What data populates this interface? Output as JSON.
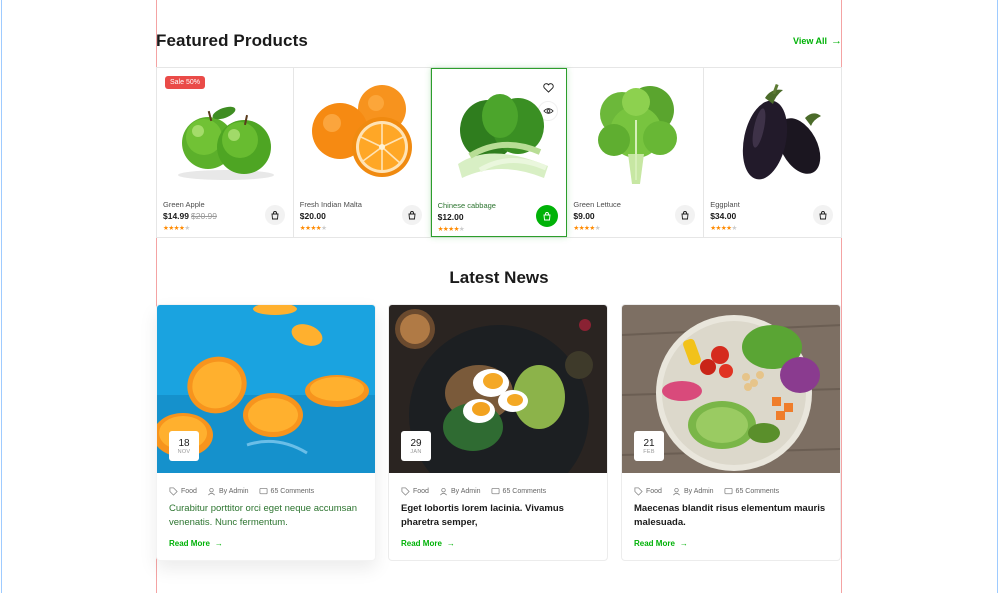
{
  "featured": {
    "title": "Featured Products",
    "view_all": "View All",
    "products": [
      {
        "name": "Green Apple",
        "price": "$14.99",
        "old_price": "$20.99",
        "badge": "Sale 50%",
        "rating": 4
      },
      {
        "name": "Fresh Indian Malta",
        "price": "$20.00",
        "old_price": "",
        "badge": "",
        "rating": 4
      },
      {
        "name": "Chinese cabbage",
        "price": "$12.00",
        "old_price": "",
        "badge": "",
        "rating": 4
      },
      {
        "name": "Green Lettuce",
        "price": "$9.00",
        "old_price": "",
        "badge": "",
        "rating": 4
      },
      {
        "name": "Eggplant",
        "price": "$34.00",
        "old_price": "",
        "badge": "",
        "rating": 4
      }
    ]
  },
  "news": {
    "title": "Latest News",
    "posts": [
      {
        "day": "18",
        "month": "NOV",
        "tag": "Food",
        "author": "By Admin",
        "comments": "65 Comments",
        "headline": "Curabitur porttitor orci eget neque accumsan venenatis. Nunc fermentum.",
        "read_more": "Read More"
      },
      {
        "day": "29",
        "month": "JAN",
        "tag": "Food",
        "author": "By Admin",
        "comments": "65 Comments",
        "headline": "Eget lobortis lorem lacinia. Vivamus pharetra semper,",
        "read_more": "Read More"
      },
      {
        "day": "21",
        "month": "FEB",
        "tag": "Food",
        "author": "By Admin",
        "comments": "65 Comments",
        "headline": "Maecenas blandit risus elementum mauris malesuada.",
        "read_more": "Read More"
      }
    ]
  },
  "colors": {
    "brand_green": "#00b207",
    "dark_green": "#2c742f",
    "sale_red": "#ea4b48",
    "star_orange": "#ff8a00"
  }
}
